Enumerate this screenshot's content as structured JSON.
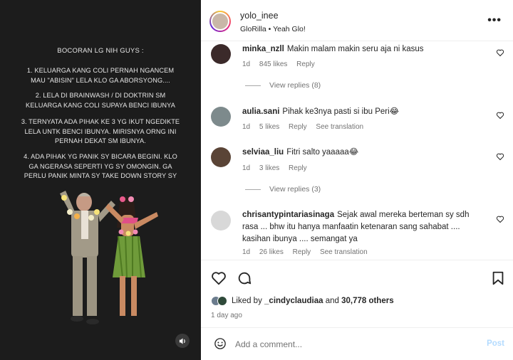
{
  "story": {
    "title": "BOCORAN LG NIH GUYS :",
    "points": [
      [
        "1. KELUARGA KANG COLI PERNAH NGANCEM",
        "MAU \"ABISIN\" LELA KLO GA ABORSYONG...."
      ],
      [
        "2. LELA DI BRAINWASH / DI DOKTRIN SM",
        "KELUARGA KANG COLI SUPAYA BENCI IBUNYA"
      ],
      [
        "3. TERNYATA ADA PIHAK KE 3 YG IKUT NGEDIKTE",
        "LELA UNTK BENCI IBUNYA. MIRISNYA ORNG INI",
        "PERNAH DEKAT SM IBUNYA."
      ],
      [
        "4. ADA PIHAK YG PANIK SY BICARA BEGINI. KLO",
        "GA NGERASA SEPERTI YG SY OMONGIN. GA",
        "PERLU PANIK MINTA SY TAKE DOWN STORY SY"
      ]
    ],
    "volume_icon": "speaker-icon"
  },
  "header": {
    "username": "yolo_inee",
    "audio": "GloRilla • Yeah Glo!",
    "more_icon": "more-horizontal-icon"
  },
  "comments": [
    {
      "user": "minka_nzll",
      "text": "Makin malam makin seru aja ni kasus",
      "age": "1d",
      "likes": "845 likes",
      "reply": "Reply",
      "translate": "",
      "view_replies": "View replies (8)",
      "avatar_color": "#3b2a2a"
    },
    {
      "user": "aulia.sani",
      "text": "Pihak ke3nya pasti si ibu Peri😂",
      "age": "1d",
      "likes": "5 likes",
      "reply": "Reply",
      "translate": "See translation",
      "view_replies": "",
      "avatar_color": "#7d8a8c"
    },
    {
      "user": "selviaa_liu",
      "text": "Fitri salto yaaaaa😂",
      "age": "1d",
      "likes": "3 likes",
      "reply": "Reply",
      "translate": "",
      "view_replies": "View replies (3)",
      "avatar_color": "#5a4436"
    },
    {
      "user": "chrisantypintariasinaga",
      "text": "Sejak awal mereka berteman sy sdh rasa ... bhw itu hanya manfaatin ketenaran sang sahabat .... kasihan ibunya .... semangat ya",
      "age": "1d",
      "likes": "26 likes",
      "reply": "Reply",
      "translate": "See translation",
      "view_replies": "",
      "avatar_color": "#d8d8d8"
    }
  ],
  "actions": {
    "liked_prefix": "Liked by ",
    "liked_user": "_cindyclaudiaa",
    "liked_and": " and ",
    "liked_count": "30,778 others",
    "time": "1 day ago",
    "add_placeholder": "Add a comment...",
    "post_label": "Post",
    "brand_blue": "#0095f6"
  }
}
